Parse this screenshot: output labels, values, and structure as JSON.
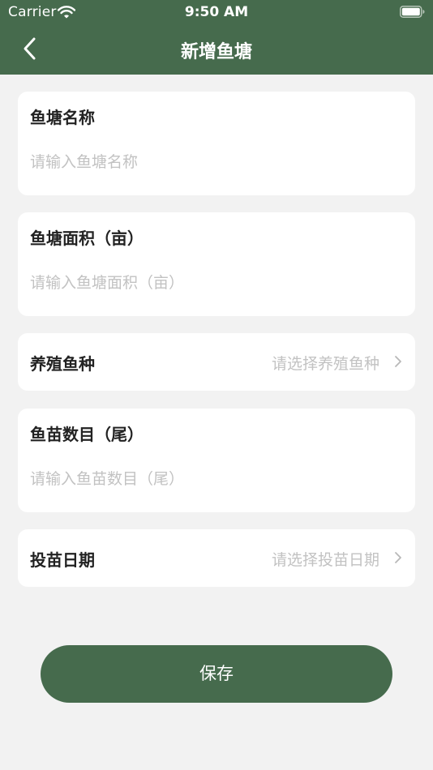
{
  "status_bar": {
    "carrier": "Carrier",
    "time": "9:50 AM"
  },
  "nav": {
    "title": "新增鱼塘",
    "back_icon": "chevron-left-icon"
  },
  "form": {
    "pond_name": {
      "label": "鱼塘名称",
      "placeholder": "请输入鱼塘名称",
      "value": ""
    },
    "pond_area": {
      "label": "鱼塘面积（亩）",
      "placeholder": "请输入鱼塘面积（亩）",
      "value": ""
    },
    "fish_species": {
      "label": "养殖鱼种",
      "placeholder": "请选择养殖鱼种"
    },
    "fry_count": {
      "label": "鱼苗数目（尾）",
      "placeholder": "请输入鱼苗数目（尾）",
      "value": ""
    },
    "stocking_date": {
      "label": "投苗日期",
      "placeholder": "请选择投苗日期"
    }
  },
  "actions": {
    "save_label": "保存"
  },
  "colors": {
    "primary": "#466b4d",
    "background": "#f2f2f2",
    "card": "#ffffff",
    "placeholder": "#c2c2c2",
    "label": "#222222"
  }
}
